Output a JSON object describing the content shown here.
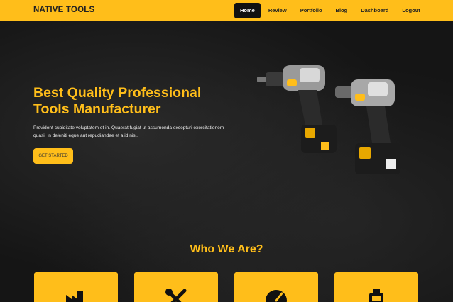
{
  "header": {
    "brand": "NATIVE TOOLS",
    "nav": [
      {
        "label": "Home",
        "active": true
      },
      {
        "label": "Review",
        "active": false
      },
      {
        "label": "Portfolio",
        "active": false
      },
      {
        "label": "Blog",
        "active": false
      },
      {
        "label": "Dashboard",
        "active": false
      },
      {
        "label": "Logout",
        "active": false
      }
    ]
  },
  "hero": {
    "title_line1": "Best Quality Professional",
    "title_line2": "Tools Manufacturer",
    "description": "Provident cupiditate voluptatem et in. Quaerat fugiat ut assumenda excepturi exercitationem quasi. In deleniti eque aut repudiandae et a id nisi.",
    "cta_label": "GET STARTED",
    "image": "power-drill-set-image"
  },
  "about": {
    "title": "Who We Are?",
    "cards": [
      {
        "icon": "factory-icon"
      },
      {
        "icon": "wrench-screwdriver-icon"
      },
      {
        "icon": "gauge-icon"
      },
      {
        "icon": "battery-icon"
      }
    ]
  },
  "colors": {
    "accent": "#ffbe1a",
    "background": "#151515",
    "nav_active": "#111111"
  }
}
